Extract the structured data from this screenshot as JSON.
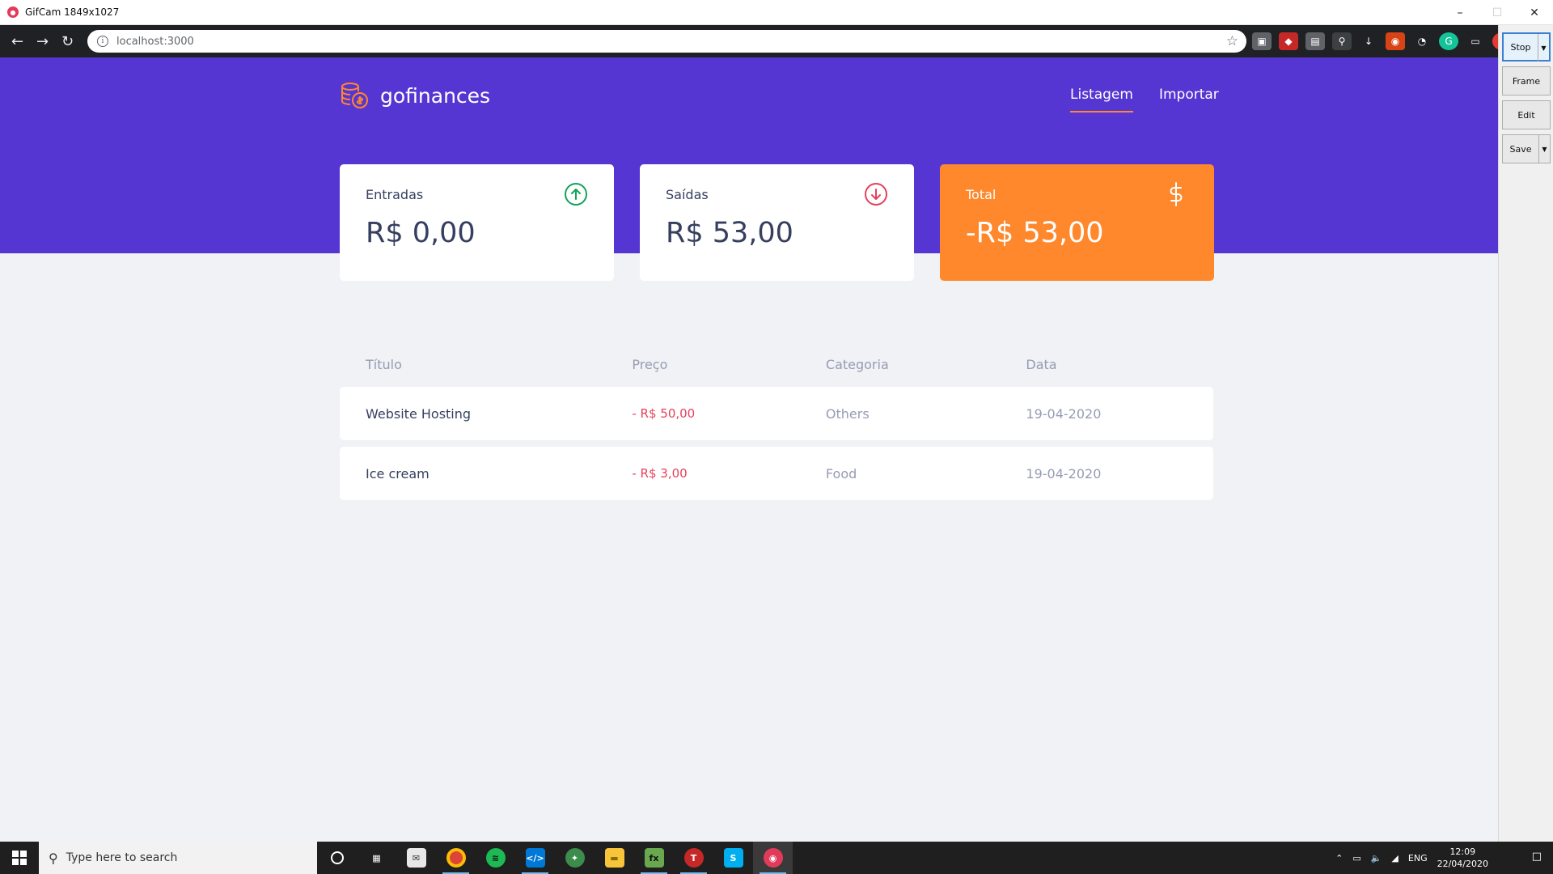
{
  "window": {
    "title": "GifCam 1849x1027"
  },
  "browser": {
    "url": "localhost:3000"
  },
  "app": {
    "brand": "gofinances",
    "nav": [
      {
        "label": "Listagem",
        "active": true
      },
      {
        "label": "Importar",
        "active": false
      }
    ],
    "cards": {
      "income": {
        "label": "Entradas",
        "value": "R$ 0,00",
        "icon": "arrow-up-circle-icon"
      },
      "outcome": {
        "label": "Saídas",
        "value": "R$ 53,00",
        "icon": "arrow-down-circle-icon"
      },
      "total": {
        "label": "Total",
        "value": "-R$ 53,00",
        "icon": "dollar-icon"
      }
    },
    "table": {
      "headers": [
        "Título",
        "Preço",
        "Categoria",
        "Data"
      ],
      "rows": [
        {
          "title": "Website Hosting",
          "price": "- R$ 50,00",
          "category": "Others",
          "date": "19-04-2020"
        },
        {
          "title": "Ice cream",
          "price": "- R$ 3,00",
          "category": "Food",
          "date": "19-04-2020"
        }
      ]
    },
    "colors": {
      "primary": "#5636d3",
      "accent": "#ff872c",
      "income": "#12a454",
      "outcome": "#e83f5b",
      "text": "#363f5f",
      "muted": "#969cb3"
    }
  },
  "gifcam": {
    "buttons": [
      "Stop",
      "Frame",
      "Edit",
      "Save"
    ]
  },
  "taskbar": {
    "search_placeholder": "Type here to search",
    "time": "12:09",
    "date": "22/04/2020",
    "language": "ENG"
  }
}
